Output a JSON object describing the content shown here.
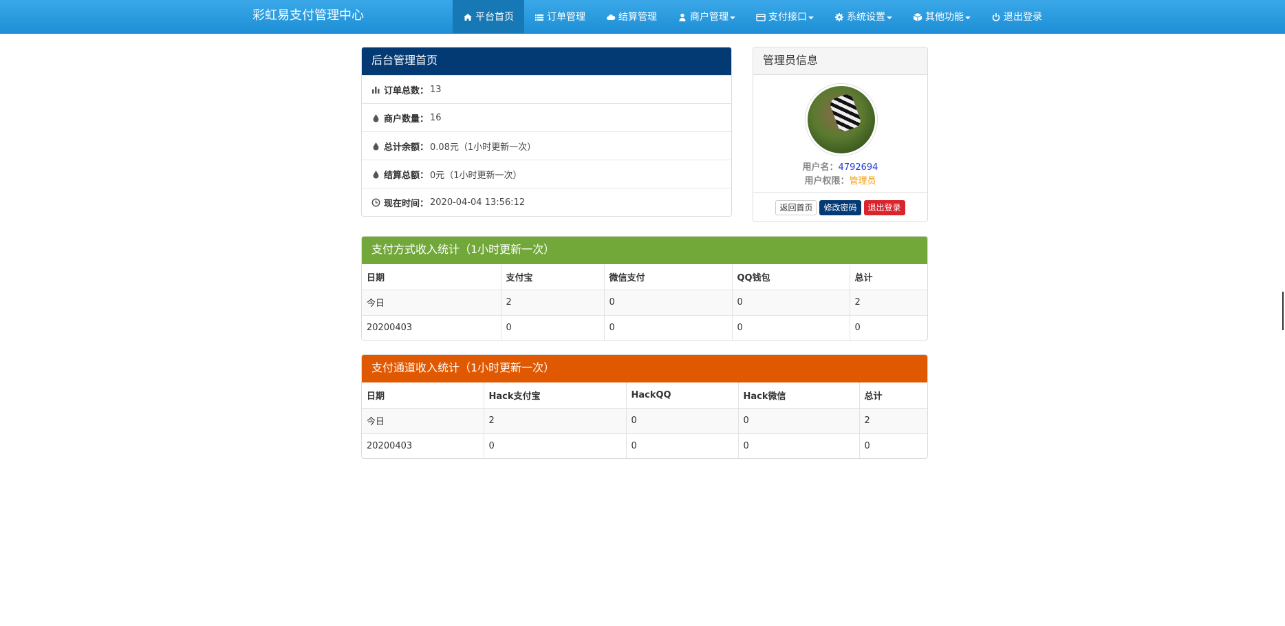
{
  "header": {
    "brand": "彩虹易支付管理中心",
    "nav": [
      {
        "label": "平台首页",
        "icon": "home-icon",
        "active": true,
        "dropdown": false
      },
      {
        "label": "订单管理",
        "icon": "list-icon",
        "active": false,
        "dropdown": false
      },
      {
        "label": "结算管理",
        "icon": "cloud-icon",
        "active": false,
        "dropdown": false
      },
      {
        "label": "商户管理",
        "icon": "user-icon",
        "active": false,
        "dropdown": true
      },
      {
        "label": "支付接口",
        "icon": "credit-card-icon",
        "active": false,
        "dropdown": true
      },
      {
        "label": "系统设置",
        "icon": "gear-icon",
        "active": false,
        "dropdown": true
      },
      {
        "label": "其他功能",
        "icon": "cube-icon",
        "active": false,
        "dropdown": true
      },
      {
        "label": "退出登录",
        "icon": "power-icon",
        "active": false,
        "dropdown": false
      }
    ]
  },
  "overview": {
    "title": "后台管理首页",
    "items": [
      {
        "icon": "bar-chart-icon",
        "label": "订单总数：",
        "value": "13"
      },
      {
        "icon": "drop-icon",
        "label": "商户数量：",
        "value": "16"
      },
      {
        "icon": "drop-icon",
        "label": "总计余额：",
        "value": "0.08元（1小时更新一次）"
      },
      {
        "icon": "drop-icon",
        "label": "结算总额：",
        "value": "0元（1小时更新一次）"
      },
      {
        "icon": "clock-icon",
        "label": "现在时间：",
        "value": " 2020-04-04 13:56:12"
      }
    ]
  },
  "admin": {
    "title": "管理员信息",
    "username_label": "用户名：",
    "username": "4792694",
    "role_label": "用户权限：",
    "role": "管理员",
    "buttons": {
      "home": "返回首页",
      "change_password": "修改密码",
      "logout": "退出登录"
    }
  },
  "payment_stats": {
    "title": "支付方式收入统计（1小时更新一次）",
    "headers": [
      "日期",
      "支付宝",
      "微信支付",
      "QQ钱包",
      "总计"
    ],
    "rows": [
      [
        "今日",
        "2",
        "0",
        "0",
        "2"
      ],
      [
        "20200403",
        "0",
        "0",
        "0",
        "0"
      ]
    ]
  },
  "channel_stats": {
    "title": "支付通道收入统计（1小时更新一次）",
    "headers": [
      "日期",
      "Hack支付宝",
      "HackQQ",
      "Hack微信",
      "总计"
    ],
    "rows": [
      [
        "今日",
        "2",
        "0",
        "0",
        "2"
      ],
      [
        "20200403",
        "0",
        "0",
        "0",
        "0"
      ]
    ]
  },
  "colors": {
    "navbar": "#1e8fd6",
    "overview_heading": "#033a74",
    "payment_heading": "#72a83a",
    "channel_heading": "#e05800"
  }
}
